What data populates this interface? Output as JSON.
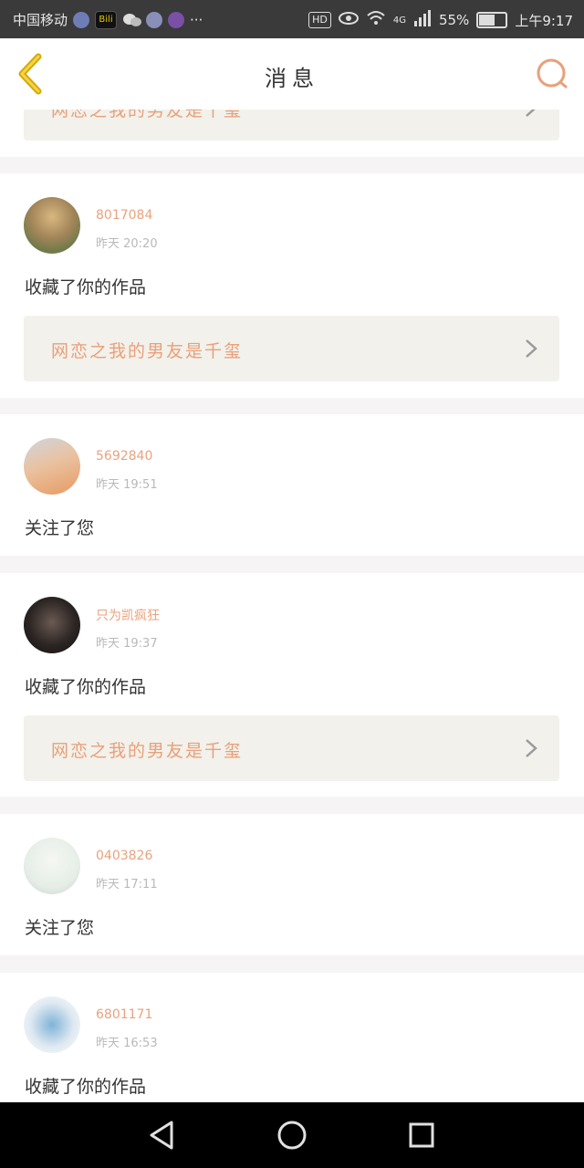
{
  "status_bar": {
    "carrier": "中国移动",
    "signal_type": "4G",
    "battery": "55%",
    "time": "上午9:17",
    "hd_label": "HD",
    "bili_label": "Bili",
    "more_label": "···"
  },
  "header": {
    "title": "消息"
  },
  "colors": {
    "accent": "#e8a07a",
    "back_icon": "#d7a900",
    "card_bg": "#f2f1eb"
  },
  "messages": [
    {
      "username": "",
      "time": "",
      "action": "",
      "work_title": "网恋之我的男友是千玺"
    },
    {
      "username": "8017084",
      "time": "昨天  20:20",
      "action": "收藏了你的作品",
      "work_title": "网恋之我的男友是千玺"
    },
    {
      "username": "5692840",
      "time": "昨天  19:51",
      "action": "关注了您"
    },
    {
      "username": "只为凯疯狂",
      "time": "昨天  19:37",
      "action": "收藏了你的作品",
      "work_title": "网恋之我的男友是千玺"
    },
    {
      "username": "0403826",
      "time": "昨天  17:11",
      "action": "关注了您"
    },
    {
      "username": "6801171",
      "time": "昨天  16:53",
      "action": "收藏了你的作品"
    }
  ]
}
